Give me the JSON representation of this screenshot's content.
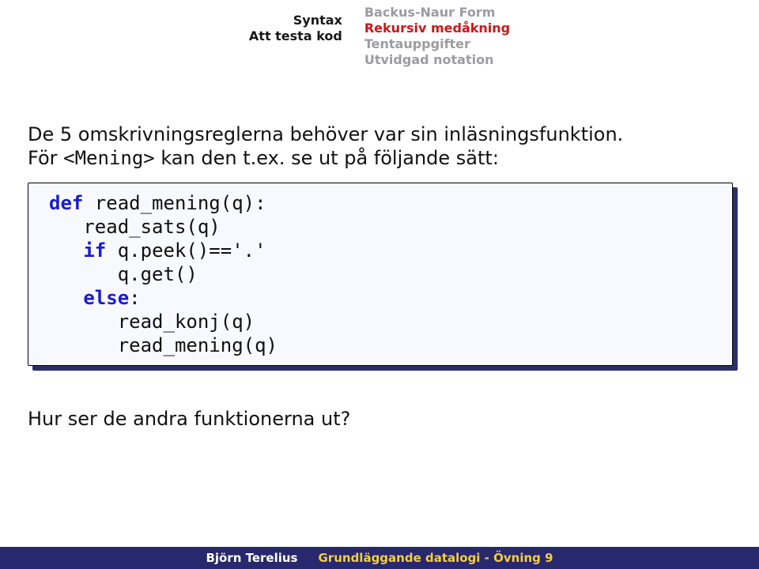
{
  "nav": {
    "left": [
      "Syntax",
      "Att testa kod"
    ],
    "right": [
      {
        "label": "Backus-Naur Form",
        "active": false
      },
      {
        "label": "Rekursiv medåkning",
        "active": true
      },
      {
        "label": "Tentauppgifter",
        "active": false
      },
      {
        "label": "Utvidgad notation",
        "active": false
      }
    ]
  },
  "body": {
    "line1a": "De 5 omskrivningsreglerna behöver var sin inläsningsfunktion.",
    "line2a": "För ",
    "line2mono": "<Mening>",
    "line2b": " kan den t.ex. se ut på följande sätt:",
    "after": "Hur ser de andra funktionerna ut?"
  },
  "code": {
    "l1_kw": "def",
    "l1_rest": " read_mening(q):",
    "l2": "   read_sats(q)",
    "l3_pad": "   ",
    "l3_kw": "if",
    "l3_rest": " q.peek()=='.'",
    "l4": "      q.get()",
    "l5_pad": "   ",
    "l5_kw": "else",
    "l5_rest": ":",
    "l6": "      read_konj(q)",
    "l7": "      read_mening(q)"
  },
  "footer": {
    "author": "Björn Terelius",
    "title": "Grundläggande datalogi - Övning 9"
  }
}
